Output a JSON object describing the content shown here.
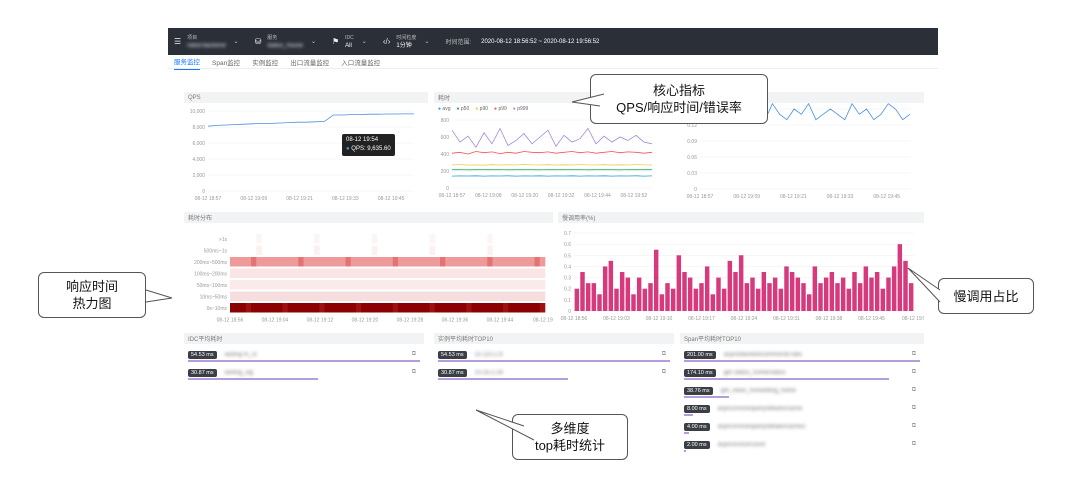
{
  "topbar": {
    "items": [
      {
        "icon": "menu-icon",
        "key": "项目",
        "value": "rated-backend"
      },
      {
        "icon": "service-icon",
        "key": "服务",
        "value": "status_house"
      },
      {
        "icon": "idc-flag-icon",
        "key": "IDC",
        "value": "All"
      },
      {
        "icon": "code-icon",
        "key": "时间粒度",
        "value": "1分钟"
      }
    ],
    "time_label": "时间范围:",
    "time_value": "2020-08-12 18:56:52 ~ 2020-08-12 19:56:52"
  },
  "tabs": [
    "服务监控",
    "Span监控",
    "实例监控",
    "出口流量监控",
    "入口流量监控"
  ],
  "qps": {
    "title": "QPS",
    "tooltip_time": "08-12 19:54",
    "tooltip_value": "QPS: 9,635.60"
  },
  "latency": {
    "title": "耗时",
    "legend": [
      "avg",
      "p50",
      "p90",
      "p99",
      "p999"
    ]
  },
  "heat": {
    "title": "耗时分布"
  },
  "slow": {
    "title": "慢调用率(%)"
  },
  "idc": {
    "title": "IDC平均耗时",
    "rows": [
      {
        "ms": "54.53 ms",
        "name": "lasting m_ct"
      },
      {
        "ms": "30.87 ms",
        "name": "lasting_sig"
      }
    ]
  },
  "inst": {
    "title": "实例平均耗时TOP10",
    "rows": [
      {
        "ms": "54.53 ms",
        "name": "10.110.2.8"
      },
      {
        "ms": "30.87 ms",
        "name": "10.25.2.26"
      }
    ]
  },
  "span": {
    "title": "Span平均耗时TOP10",
    "rows": [
      {
        "ms": "201.00 ms",
        "name": "asyncblacklistcommon/BTabs"
      },
      {
        "ms": "174.10 ms",
        "name": "get status_home/status"
      },
      {
        "ms": "38.76 ms",
        "name": "get_news_home/blog_home"
      },
      {
        "ms": "8.00 ms",
        "name": "asyncsrvice/query/details/cache"
      },
      {
        "ms": "4.00 ms",
        "name": "asyncsrvice/query/details/cache2"
      },
      {
        "ms": "2.00 ms",
        "name": "asyncsrvice/count"
      }
    ]
  },
  "callouts": {
    "core1": "核心指标",
    "core2": "QPS/响应时间/错误率",
    "heat1": "响应时间",
    "heat2": "热力图",
    "slow": "慢调用占比",
    "dim1": "多维度",
    "dim2": "top耗时统计"
  },
  "chart_data": [
    {
      "type": "line",
      "title": "QPS",
      "categories": [
        "08-12 18:57",
        "08-12 19:09",
        "08-12 19:21",
        "08-12 19:33",
        "08-12 19:45"
      ],
      "yticks": [
        "0",
        "2,000",
        "4,000",
        "6,000",
        "8,000",
        "10,000"
      ],
      "ylim": [
        0,
        10000
      ],
      "series": [
        {
          "values": [
            8100,
            8200,
            8250,
            8300,
            8350,
            8400,
            8450,
            8450,
            8500,
            8550,
            8600,
            8600,
            8650,
            8700,
            9500,
            9500,
            9550,
            9550,
            9600,
            9600,
            9620,
            9630,
            9635,
            9640
          ]
        }
      ]
    },
    {
      "type": "line",
      "title": "耗时",
      "categories": [
        "08-12 18:57",
        "08-12 19:08",
        "08-12 19:20",
        "08-12 19:32",
        "08-12 19:44",
        "08-12 19:52"
      ],
      "yticks": [
        "0",
        "200",
        "400",
        "600",
        "800"
      ],
      "ylim": [
        0,
        800
      ],
      "series": [
        {
          "name": "p999",
          "values": [
            680,
            540,
            610,
            480,
            650,
            520,
            700,
            500,
            560,
            640,
            520,
            600,
            680,
            490,
            620,
            540,
            580,
            700,
            520,
            610,
            540,
            600,
            560,
            620,
            540,
            520
          ]
        },
        {
          "name": "p99",
          "values": [
            410,
            420,
            400,
            430,
            415,
            425,
            405,
            420,
            410,
            430,
            420,
            415,
            425,
            410,
            420,
            430,
            415,
            425,
            410,
            420,
            430,
            415,
            425,
            420,
            410,
            420
          ]
        },
        {
          "name": "p90",
          "values": [
            270,
            275,
            270,
            272,
            268,
            274,
            271,
            273,
            270,
            276,
            272,
            270,
            274,
            271,
            273,
            270,
            275,
            272,
            270,
            274,
            271,
            273,
            270,
            275,
            272,
            270
          ]
        },
        {
          "name": "p50",
          "values": [
            215,
            216,
            214,
            215,
            217,
            215,
            216,
            214,
            215,
            216,
            215,
            214,
            216,
            215,
            217,
            215,
            216,
            214,
            215,
            216,
            215,
            214,
            216,
            215,
            217,
            215
          ]
        },
        {
          "name": "avg",
          "values": [
            140,
            142,
            141,
            143,
            140,
            142,
            141,
            143,
            140,
            142,
            141,
            143,
            140,
            142,
            141,
            143,
            140,
            142,
            141,
            143,
            140,
            142,
            141,
            143,
            140,
            142
          ]
        }
      ]
    },
    {
      "type": "line",
      "title": "",
      "categories": [
        "08-12 18:57",
        "08-12 19:09",
        "08-12 19:21",
        "08-12 19:33",
        "08-12 19:45"
      ],
      "yticks": [
        "0",
        "0.03",
        "0.06",
        "0.09",
        "0.12",
        "0.15"
      ],
      "ylim": [
        0,
        0.15
      ],
      "series": [
        {
          "values": [
            0.14,
            0.15,
            0.13,
            0.15,
            0.14,
            0.16,
            0.13,
            0.14,
            0.15,
            0.13,
            0.16,
            0.14,
            0.13,
            0.15,
            0.14,
            0.16,
            0.13,
            0.14,
            0.15,
            0.14,
            0.13,
            0.16,
            0.14,
            0.15,
            0.13,
            0.14,
            0.16,
            0.15,
            0.13,
            0.14
          ]
        }
      ]
    },
    {
      "type": "heatmap",
      "title": "耗时分布",
      "categories": [
        "08-12 18:56",
        "08-12 19:04",
        "08-12 19:12",
        "08-12 19:20",
        "08-12 19:28",
        "08-12 19:36",
        "08-12 19:44",
        "08-12 19:5"
      ],
      "rows": [
        "0s~10ms",
        "10ms~50ms",
        "50ms~100ms",
        "100ms~200ms",
        "200ms~500ms",
        "500ms~1s",
        ">1s"
      ]
    },
    {
      "type": "bar",
      "title": "慢调用率(%)",
      "categories": [
        "08-12 18:56",
        "08-12 19:03",
        "08-12 19:10",
        "08-12 19:17",
        "08-12 19:24",
        "08-12 19:31",
        "08-12 19:38",
        "08-12 19:45",
        "08-12 19:5"
      ],
      "yticks": [
        "0",
        "0.1",
        "0.2",
        "0.3",
        "0.4",
        "0.5",
        "0.6",
        "0.7"
      ],
      "ylim": [
        0,
        0.7
      ],
      "values": [
        0.2,
        0.35,
        0.25,
        0.25,
        0.15,
        0.4,
        0.45,
        0.2,
        0.35,
        0.3,
        0.15,
        0.3,
        0.2,
        0.25,
        0.55,
        0.15,
        0.25,
        0.2,
        0.5,
        0.35,
        0.3,
        0.2,
        0.25,
        0.4,
        0.15,
        0.3,
        0.2,
        0.45,
        0.35,
        0.5,
        0.25,
        0.3,
        0.2,
        0.35,
        0.25,
        0.3,
        0.2,
        0.4,
        0.35,
        0.3,
        0.25,
        0.15,
        0.4,
        0.25,
        0.3,
        0.35,
        0.25,
        0.3,
        0.2,
        0.35,
        0.25,
        0.4,
        0.3,
        0.35,
        0.2,
        0.3,
        0.4,
        0.6,
        0.45,
        0.25
      ]
    }
  ]
}
